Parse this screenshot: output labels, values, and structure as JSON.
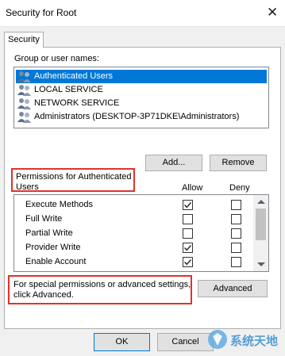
{
  "window": {
    "title": "Security for Root"
  },
  "tabs": [
    {
      "label": "Security"
    }
  ],
  "groups": {
    "label": "Group or user names:",
    "items": [
      {
        "name": "Authenticated Users",
        "selected": true
      },
      {
        "name": "LOCAL SERVICE",
        "selected": false
      },
      {
        "name": "NETWORK SERVICE",
        "selected": false
      },
      {
        "name": "Administrators (DESKTOP-3P71DKE\\Administrators)",
        "selected": false
      }
    ]
  },
  "buttons": {
    "add": "Add...",
    "remove": "Remove",
    "advanced": "Advanced",
    "ok": "OK",
    "cancel": "Cancel"
  },
  "permissions": {
    "label_line1": "Permissions for Authenticated",
    "label_line2": "Users",
    "allow_header": "Allow",
    "deny_header": "Deny",
    "rows": [
      {
        "name": "Execute Methods",
        "allow": true,
        "deny": false
      },
      {
        "name": "Full Write",
        "allow": false,
        "deny": false
      },
      {
        "name": "Partial Write",
        "allow": false,
        "deny": false
      },
      {
        "name": "Provider Write",
        "allow": true,
        "deny": false
      },
      {
        "name": "Enable Account",
        "allow": true,
        "deny": false
      }
    ]
  },
  "special": {
    "line1": "For special permissions or advanced settings,",
    "line2": "click Advanced."
  },
  "watermark": {
    "text": "系统天地"
  },
  "colors": {
    "selection": "#0078d7",
    "annotation_red": "#e0322b"
  }
}
